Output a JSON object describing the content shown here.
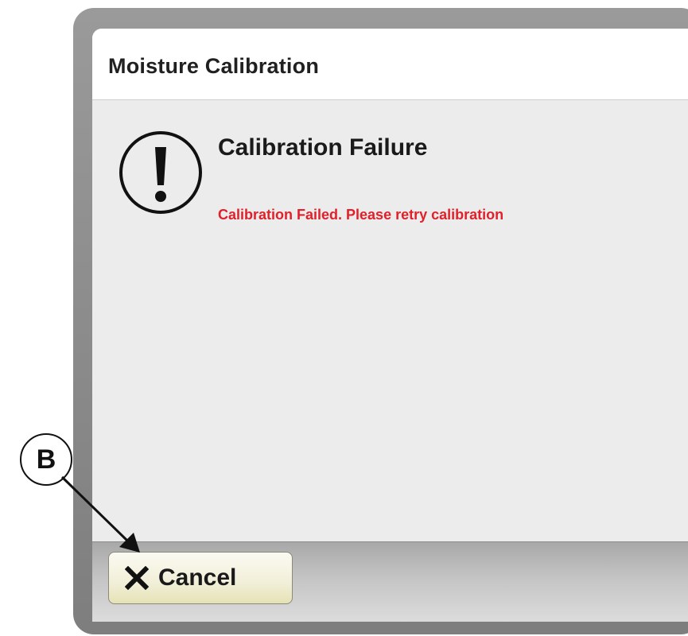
{
  "dialog": {
    "title": "Moisture Calibration",
    "alert_icon": "exclamation-circle-icon",
    "heading": "Calibration Failure",
    "message": "Calibration Failed. Please retry calibration",
    "message_color": "#e0202a"
  },
  "footer": {
    "cancel_label": "Cancel",
    "cancel_icon": "close-icon"
  },
  "callout": {
    "label": "B"
  }
}
